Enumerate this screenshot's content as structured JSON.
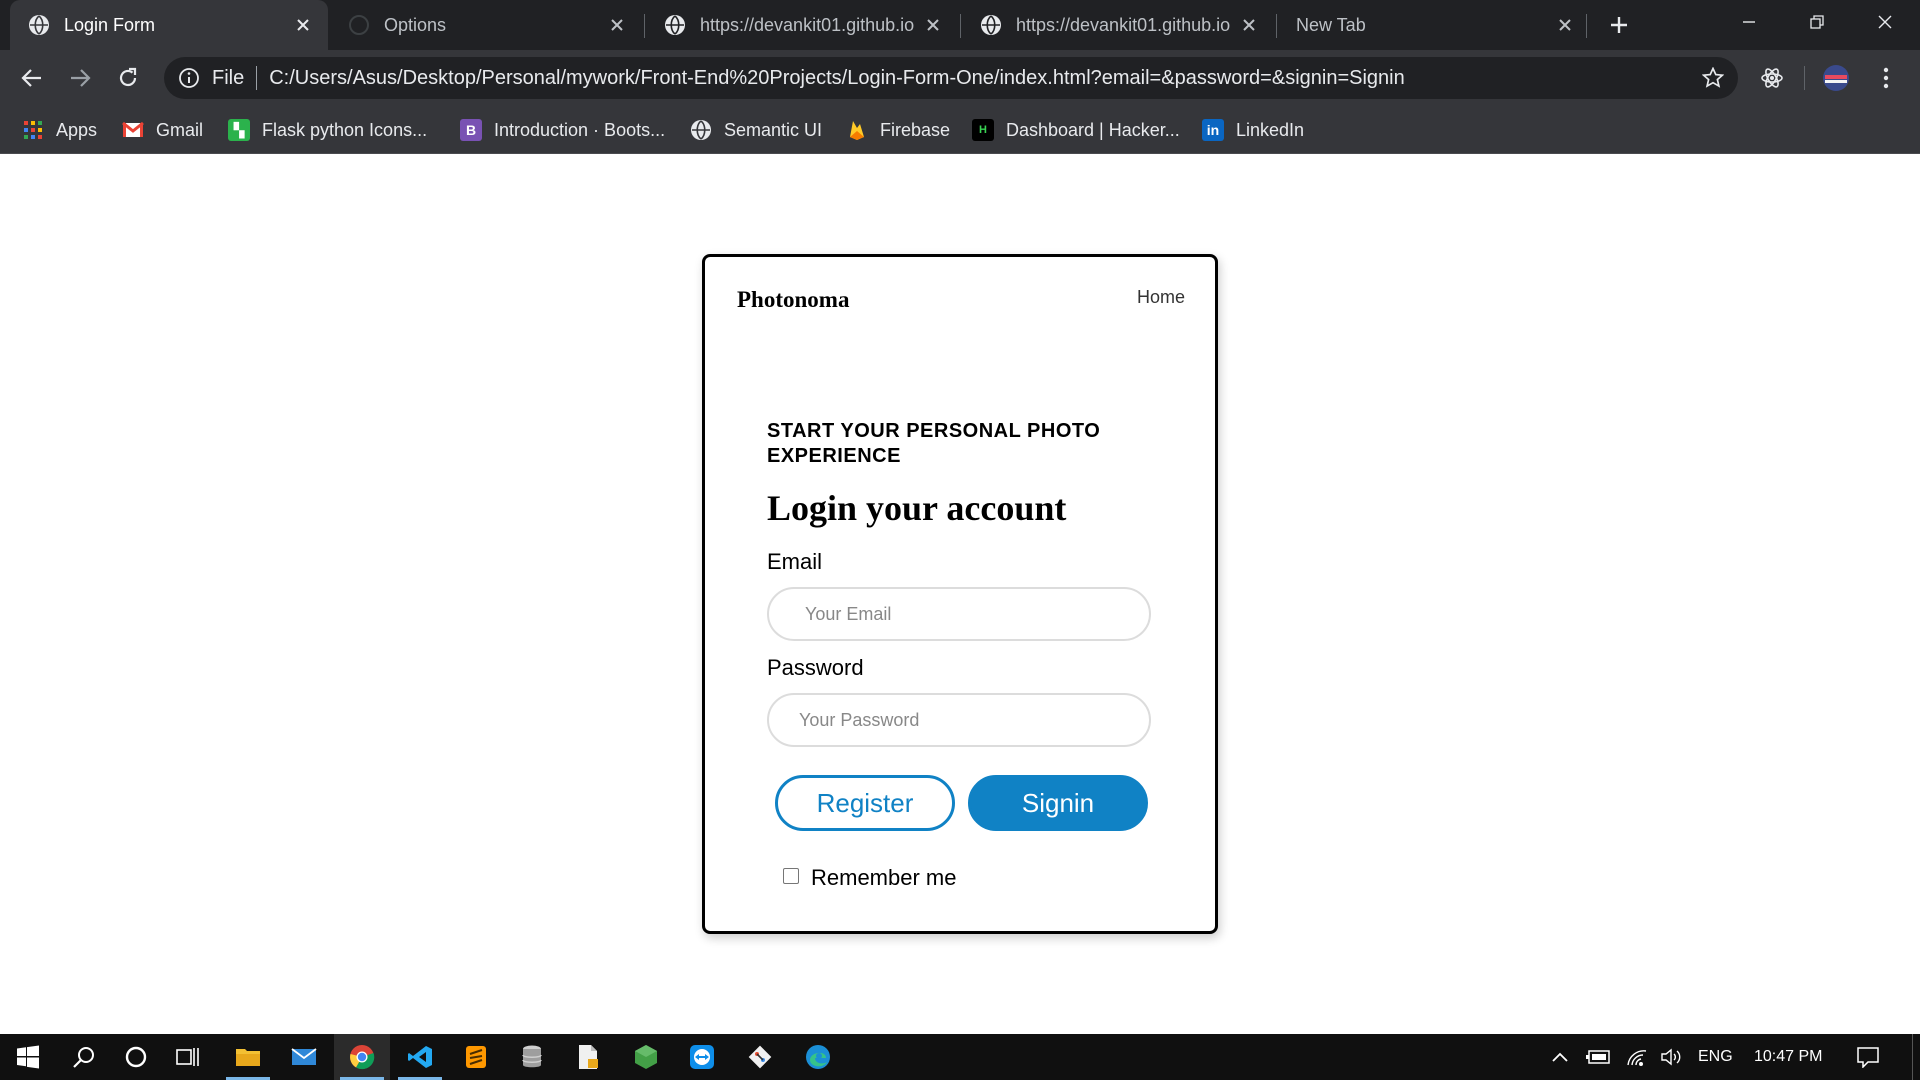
{
  "tabs": [
    {
      "title": "Login Form",
      "active": true
    },
    {
      "title": "Options",
      "active": false
    },
    {
      "title": "https://devankit01.github.io",
      "active": false
    },
    {
      "title": "https://devankit01.github.io",
      "active": false
    },
    {
      "title": "New Tab",
      "active": false
    }
  ],
  "omnibox": {
    "scheme_label": "File",
    "url": "C:/Users/Asus/Desktop/Personal/mywork/Front-End%20Projects/Login-Form-One/index.html?email=&password=&signin=Signin"
  },
  "bookmarks": [
    {
      "label": "Apps",
      "icon": "apps-grid-icon"
    },
    {
      "label": "Gmail",
      "icon": "gmail-icon"
    },
    {
      "label": "Flask python Icons...",
      "icon": "flask-icons-icon"
    },
    {
      "label": "Introduction · Boots...",
      "icon": "bootstrap-icon"
    },
    {
      "label": "Semantic UI",
      "icon": "globe-icon"
    },
    {
      "label": "Firebase",
      "icon": "firebase-icon"
    },
    {
      "label": "Dashboard | Hacker...",
      "icon": "hackerrank-icon"
    },
    {
      "label": "LinkedIn",
      "icon": "linkedin-icon"
    }
  ],
  "page": {
    "brand": "Photonoma",
    "nav_home": "Home",
    "subheading": "START YOUR PERSONAL PHOTO EXPERIENCE",
    "title": "Login your account",
    "email_label": "Email",
    "email_placeholder": "Your Email",
    "password_label": "Password",
    "password_placeholder": "Your Password",
    "register_label": "Register",
    "signin_label": "Signin",
    "remember_label": "Remember me"
  },
  "tray": {
    "language": "ENG",
    "time": "10:47 PM"
  },
  "colors": {
    "accent": "#1082c5",
    "chrome_dark": "#202124",
    "chrome_toolbar": "#35363a"
  }
}
